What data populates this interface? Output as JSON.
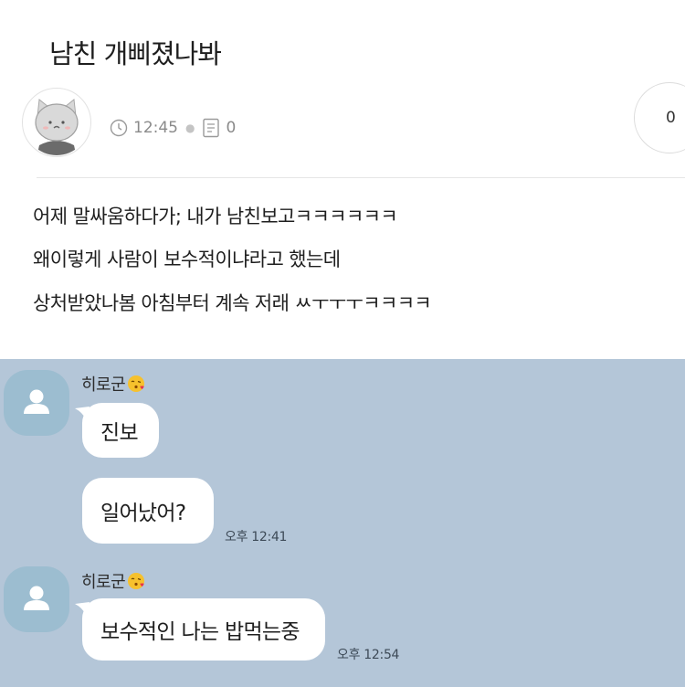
{
  "post": {
    "title": "남친 개삐졌나봐",
    "time": "12:45",
    "comment_count": "0",
    "like_count": "0",
    "body_lines": [
      "어제 말싸움하다가; 내가 남친보고ㅋㅋㅋㅋㅋㅋ",
      "왜이렇게 사람이 보수적이냐라고 했는데",
      "상처받았나봄 아침부터 계속 저래 ㅆㅜㅜㅜㅋㅋㅋㅋ"
    ]
  },
  "chat": {
    "groups": [
      {
        "sender": "히로군",
        "messages": [
          "진보",
          "일어났어?"
        ],
        "time": "오후 12:41"
      },
      {
        "sender": "히로군",
        "messages": [
          "보수적인 나는 밥먹는중"
        ],
        "time": "오후 12:54"
      }
    ]
  },
  "colors": {
    "chat_background": "#b4c6d8",
    "bubble": "#ffffff",
    "avatar": "#9cbdd0"
  }
}
